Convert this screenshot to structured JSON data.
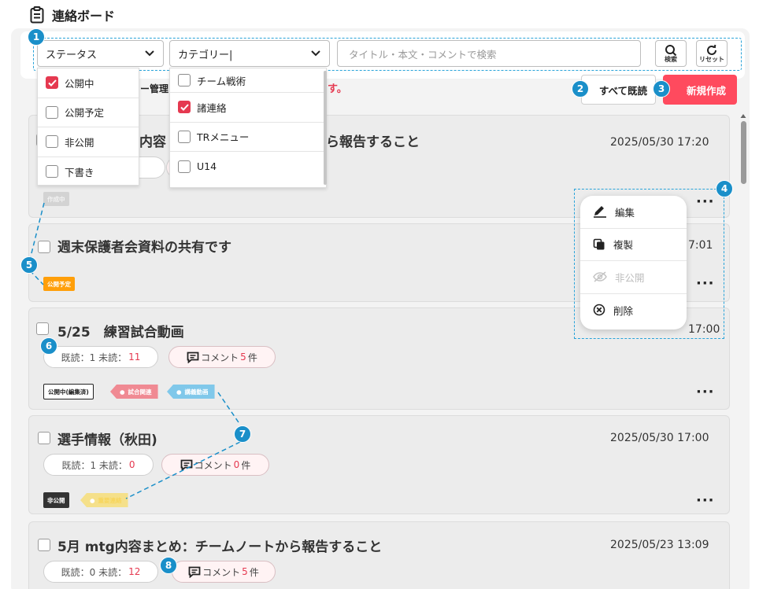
{
  "header": {
    "title": "連絡ボード"
  },
  "filters": {
    "status_label": "ステータス",
    "category_label": "カテゴリー",
    "search_placeholder": "タイトル・本文・コメントで検索",
    "search_label": "検索",
    "reset_label": "リセット"
  },
  "status_options": [
    {
      "label": "公開中",
      "checked": true
    },
    {
      "label": "公開予定",
      "checked": false
    },
    {
      "label": "非公開",
      "checked": false
    },
    {
      "label": "下書き",
      "checked": false
    }
  ],
  "category_options": [
    {
      "label": "チーム戦術",
      "checked": false
    },
    {
      "label": "諸連絡",
      "checked": true
    },
    {
      "label": "TRメニュー",
      "checked": false
    },
    {
      "label": "U14",
      "checked": false
    }
  ],
  "notice": {
    "fragment_left": "ー管理",
    "fragment_right": "す。"
  },
  "actions": {
    "read_all": "すべて既読",
    "new": "新規作成"
  },
  "menu": [
    {
      "label": "編集",
      "icon": "pencil-icon"
    },
    {
      "label": "複製",
      "icon": "copy-icon"
    },
    {
      "label": "非公開",
      "icon": "eye-off-icon",
      "disabled": true
    },
    {
      "label": "削除",
      "icon": "delete-circle-icon"
    }
  ],
  "cards": [
    {
      "title_fragment_a": "内容",
      "title_fragment_b": "ら報告すること",
      "date": "2025/05/30 17:20",
      "status_badge": "作成中"
    },
    {
      "title": "週末保護者会資料の共有です",
      "date_fragment": "7:01",
      "status_badge": "公開予定"
    },
    {
      "title": "5/25　練習試合動画",
      "date_fragment": "17:00",
      "read_label": "既読：1 未読：",
      "unread": "11",
      "comment_label": "コメント",
      "comment_count": "5",
      "comment_unit": "件",
      "status_badge": "公開中(編集済)",
      "tags": [
        "試合関連",
        "講義動画"
      ]
    },
    {
      "title": "選手情報（秋田)",
      "date": "2025/05/30 17:00",
      "read_label": "既読：1 未読：",
      "unread": "0",
      "comment_label": "コメント",
      "comment_count": "0",
      "comment_unit": "件",
      "status_badge": "非公開",
      "tags": [
        "重要連絡"
      ]
    },
    {
      "title": "5月 mtg内容まとめ：チームノートから報告すること",
      "date": "2025/05/23 13:09",
      "read_label": "既読：0 未読：",
      "unread": "12",
      "comment_label": "コメント",
      "comment_count": "5",
      "comment_unit": "件"
    }
  ],
  "markers": [
    "1",
    "2",
    "3",
    "4",
    "5",
    "6",
    "7",
    "7",
    "8"
  ],
  "colors": {
    "accent": "#1a8fc9",
    "primary_button": "#ff4a5e",
    "unread": "#e53950",
    "badge_scheduled": "#ff9f0a",
    "badge_private": "#333333",
    "tag_match": "#f08a93",
    "tag_video": "#80c8ea",
    "tag_important": "#f5e08a"
  }
}
